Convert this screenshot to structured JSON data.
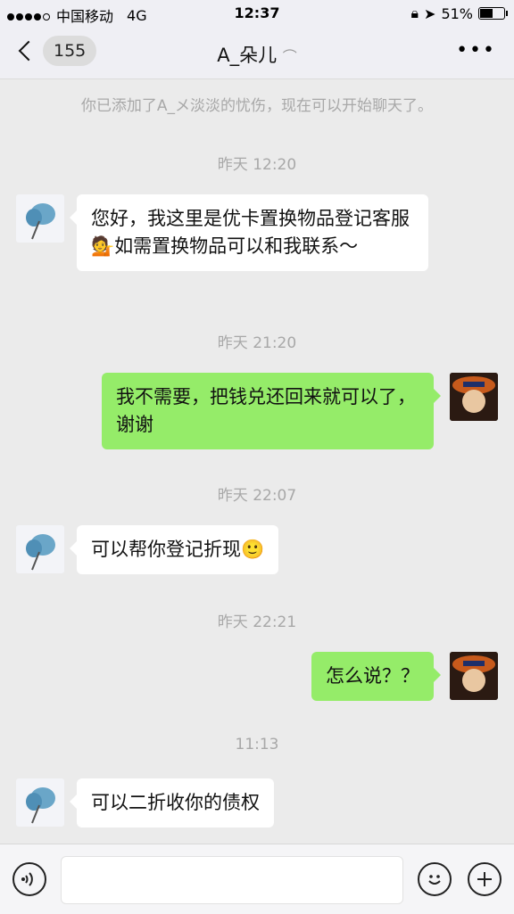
{
  "status_bar": {
    "carrier": "中国移动",
    "network": "4G",
    "time": "12:37",
    "battery": "51%"
  },
  "nav": {
    "back_count": "155",
    "title": "A_朵儿",
    "more": "•••"
  },
  "system_message": "你已添加了A_メ淡淡的忧伤，现在可以开始聊天了。",
  "messages": [
    {
      "timestamp": "昨天 12:20",
      "side": "in",
      "text": "您好，我这里是优卡置换物品登记客服💁如需置换物品可以和我联系～"
    },
    {
      "timestamp": "昨天 21:20",
      "side": "out",
      "text": "我不需要，把钱兑还回来就可以了，谢谢"
    },
    {
      "timestamp": "昨天 22:07",
      "side": "in",
      "text": "可以帮你登记折现🙂"
    },
    {
      "timestamp": "昨天 22:21",
      "side": "out",
      "text": "怎么说？？"
    },
    {
      "timestamp": "11:13",
      "side": "in",
      "text": "可以二折收你的债权"
    }
  ],
  "input_bar": {
    "voice_icon": "voice-icon",
    "emoji_icon": "emoji-icon",
    "plus_icon": "plus-icon"
  }
}
